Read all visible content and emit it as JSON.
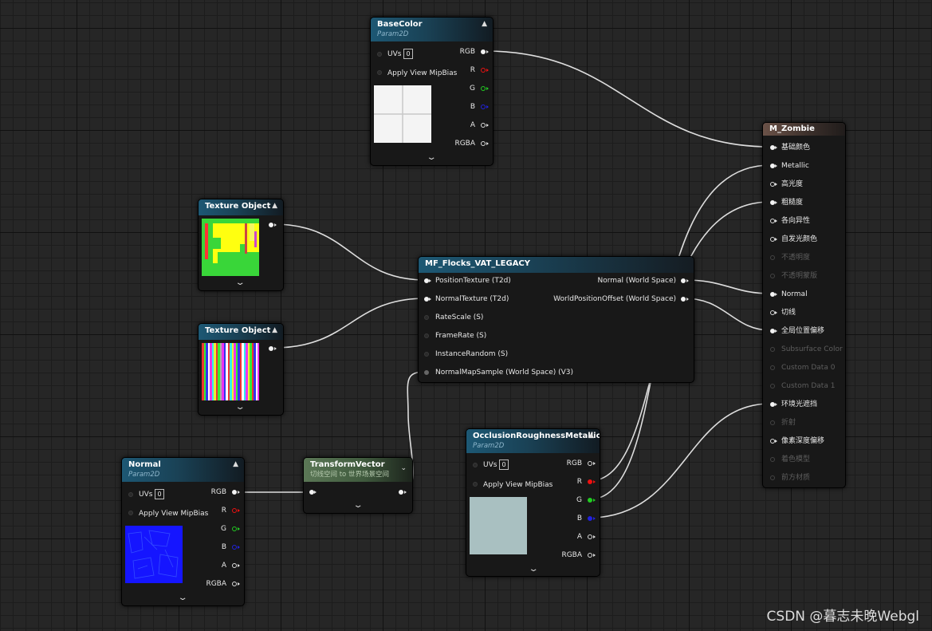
{
  "graph": {
    "nodes": {
      "basecolor": {
        "title": "BaseColor",
        "subtitle": "Param2D",
        "uvs_label": "UVs",
        "uvs_value": "0",
        "mipbias_label": "Apply View MipBias",
        "outputs": [
          "RGB",
          "R",
          "G",
          "B",
          "A",
          "RGBA"
        ]
      },
      "texobj1": {
        "title": "Texture Object"
      },
      "texobj2": {
        "title": "Texture Object"
      },
      "mf": {
        "title": "MF_Flocks_VAT_LEGACY",
        "inputs": [
          "PositionTexture (T2d)",
          "NormalTexture (T2d)",
          "RateScale (S)",
          "FrameRate (S)",
          "InstanceRandom (S)",
          "NormalMapSample (World Space) (V3)"
        ],
        "outputs": [
          "Normal (World Space)",
          "WorldPositionOffset (World Space)"
        ]
      },
      "normal": {
        "title": "Normal",
        "subtitle": "Param2D",
        "uvs_label": "UVs",
        "uvs_value": "0",
        "mipbias_label": "Apply View MipBias",
        "outputs": [
          "RGB",
          "R",
          "G",
          "B",
          "A",
          "RGBA"
        ]
      },
      "transform": {
        "title": "TransformVector",
        "subtitle": "切线空间 to 世界场景空间"
      },
      "orm": {
        "title": "OcclusionRoughnessMetallic",
        "subtitle": "Param2D",
        "uvs_label": "UVs",
        "uvs_value": "0",
        "mipbias_label": "Apply View MipBias",
        "outputs": [
          "RGB",
          "R",
          "G",
          "B",
          "A",
          "RGBA"
        ]
      },
      "material": {
        "title": "M_Zombie",
        "inputs": [
          "基础颜色",
          "Metallic",
          "高光度",
          "粗糙度",
          "各向异性",
          "自发光颜色",
          "不透明度",
          "不透明蒙版",
          "Normal",
          "切线",
          "全局位置偏移",
          "Subsurface Color",
          "Custom Data 0",
          "Custom Data 1",
          "环境光遮挡",
          "折射",
          "像素深度偏移",
          "着色模型",
          "前方材质"
        ]
      }
    },
    "colors": {
      "wire": "#e0e0e0",
      "red": "#e11111",
      "green": "#22cc22",
      "blue": "#2222dd",
      "grid": "#262626"
    }
  },
  "watermark": "CSDN @暮志未晚Webgl"
}
